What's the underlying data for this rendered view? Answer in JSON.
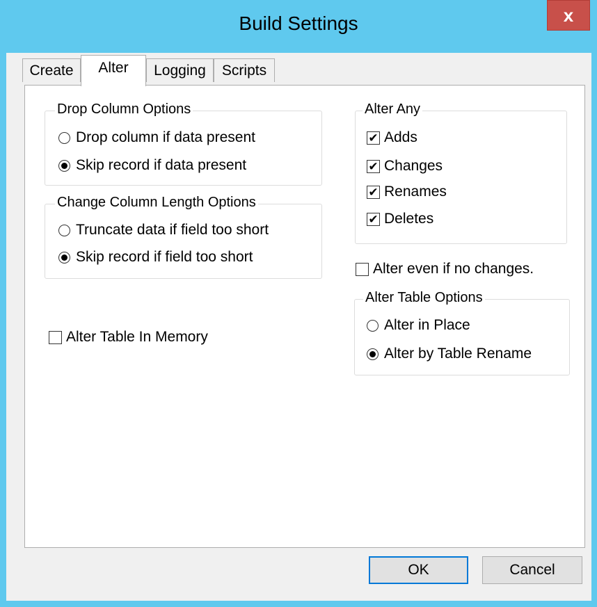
{
  "window": {
    "title": "Build Settings",
    "close_glyph": "x"
  },
  "tabs": [
    {
      "label": "Create",
      "active": false
    },
    {
      "label": "Alter",
      "active": true
    },
    {
      "label": "Logging",
      "active": false
    },
    {
      "label": "Scripts",
      "active": false
    }
  ],
  "drop_column": {
    "legend": "Drop Column Options",
    "options": [
      {
        "label": "Drop column if data present",
        "selected": false
      },
      {
        "label": "Skip record if data present",
        "selected": true
      }
    ]
  },
  "change_length": {
    "legend": "Change Column Length Options",
    "options": [
      {
        "label": "Truncate data if field too short",
        "selected": false
      },
      {
        "label": "Skip record if field too short",
        "selected": true
      }
    ]
  },
  "alter_in_memory": {
    "label": "Alter Table In Memory",
    "checked": false
  },
  "alter_any": {
    "legend": "Alter Any",
    "items": [
      {
        "label": "Adds",
        "checked": true
      },
      {
        "label": "Changes",
        "checked": true
      },
      {
        "label": "Renames",
        "checked": true
      },
      {
        "label": "Deletes",
        "checked": true
      }
    ]
  },
  "alter_even": {
    "label": "Alter even if no changes.",
    "checked": false
  },
  "alter_table_options": {
    "legend": "Alter Table Options",
    "options": [
      {
        "label": "Alter in Place",
        "selected": false
      },
      {
        "label": "Alter by Table Rename",
        "selected": true
      }
    ]
  },
  "buttons": {
    "ok": "OK",
    "cancel": "Cancel"
  },
  "check_glyph": "✔"
}
